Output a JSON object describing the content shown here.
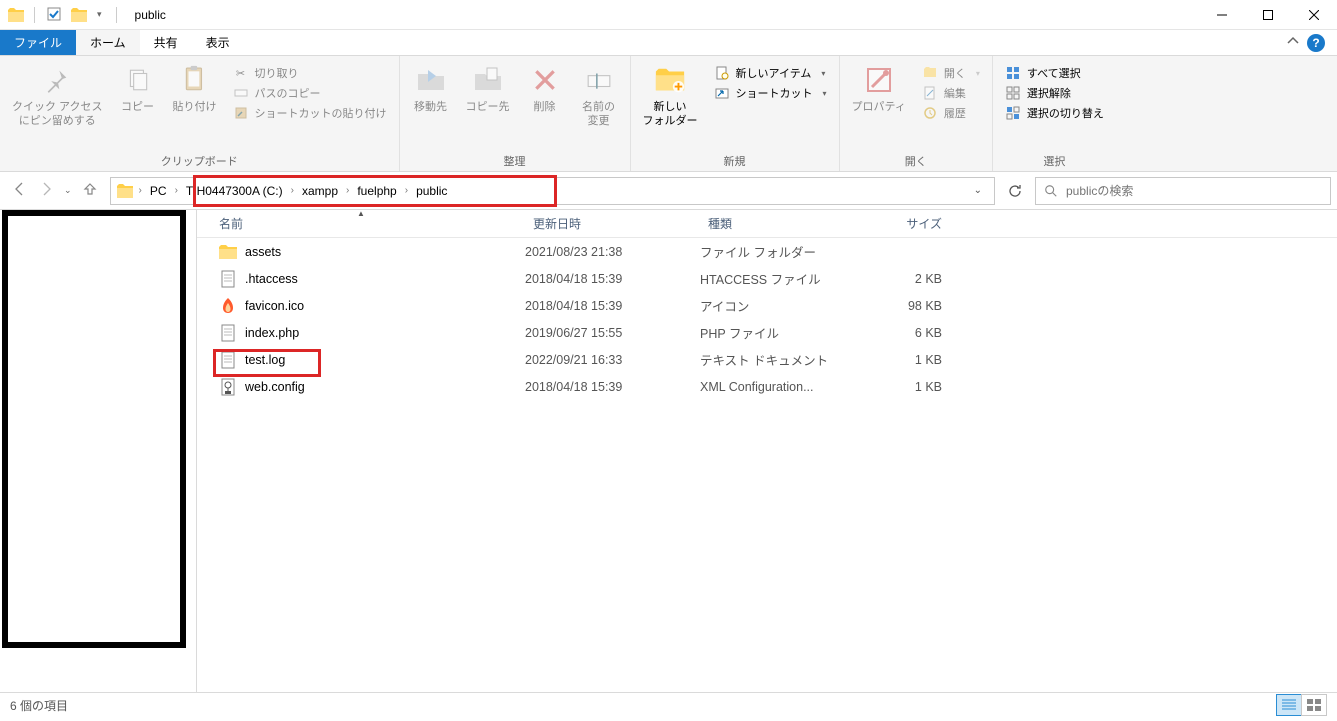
{
  "window": {
    "title": "public"
  },
  "tabs": {
    "file": "ファイル",
    "home": "ホーム",
    "share": "共有",
    "view": "表示"
  },
  "ribbon": {
    "clipboard": {
      "label": "クリップボード",
      "pin": "クイック アクセス\nにピン留めする",
      "copy": "コピー",
      "paste": "貼り付け",
      "cut": "切り取り",
      "copypath": "パスのコピー",
      "pasteshortcut": "ショートカットの貼り付け"
    },
    "organize": {
      "label": "整理",
      "moveto": "移動先",
      "copyto": "コピー先",
      "delete": "削除",
      "rename": "名前の\n変更"
    },
    "new": {
      "label": "新規",
      "newfolder": "新しい\nフォルダー",
      "newitem": "新しいアイテム",
      "shortcut": "ショートカット"
    },
    "open": {
      "label": "開く",
      "properties": "プロパティ",
      "open": "開く",
      "edit": "編集",
      "history": "履歴"
    },
    "select": {
      "label": "選択",
      "selectall": "すべて選択",
      "selectnone": "選択解除",
      "invert": "選択の切り替え"
    }
  },
  "breadcrumb": {
    "pc": "PC",
    "drive": "TIH0447300A (C:)",
    "p1": "xampp",
    "p2": "fuelphp",
    "p3": "public"
  },
  "search": {
    "placeholder": "publicの検索"
  },
  "columns": {
    "name": "名前",
    "date": "更新日時",
    "type": "種類",
    "size": "サイズ"
  },
  "files": [
    {
      "name": "assets",
      "date": "2021/08/23 21:38",
      "type": "ファイル フォルダー",
      "size": "",
      "icon": "folder"
    },
    {
      "name": ".htaccess",
      "date": "2018/04/18 15:39",
      "type": "HTACCESS ファイル",
      "size": "2 KB",
      "icon": "file"
    },
    {
      "name": "favicon.ico",
      "date": "2018/04/18 15:39",
      "type": "アイコン",
      "size": "98 KB",
      "icon": "favicon"
    },
    {
      "name": "index.php",
      "date": "2019/06/27 15:55",
      "type": "PHP ファイル",
      "size": "6 KB",
      "icon": "file"
    },
    {
      "name": "test.log",
      "date": "2022/09/21 16:33",
      "type": "テキスト ドキュメント",
      "size": "1 KB",
      "icon": "file",
      "highlighted": true
    },
    {
      "name": "web.config",
      "date": "2018/04/18 15:39",
      "type": "XML Configuration...",
      "size": "1 KB",
      "icon": "xml"
    }
  ],
  "status": {
    "count": "6 個の項目"
  }
}
